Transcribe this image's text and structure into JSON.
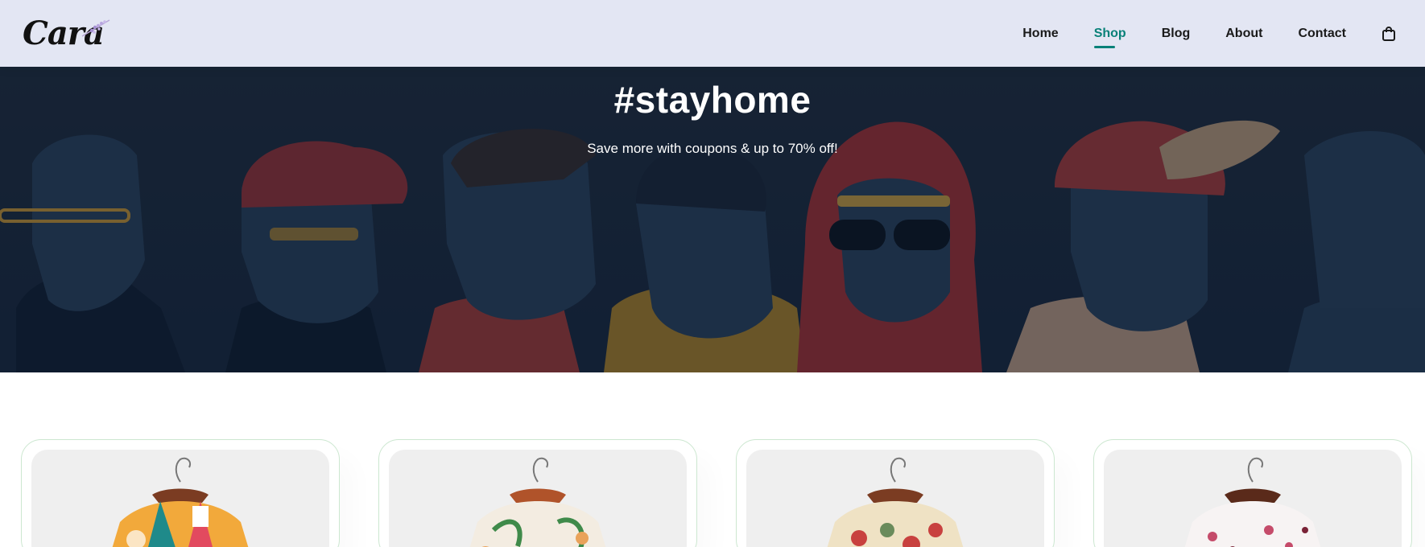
{
  "brand": {
    "name": "Cara",
    "accent": "#088178",
    "header_bg": "#e3e6f3"
  },
  "nav": {
    "items": [
      {
        "label": "Home",
        "active": false
      },
      {
        "label": "Shop",
        "active": true
      },
      {
        "label": "Blog",
        "active": false
      },
      {
        "label": "About",
        "active": false
      },
      {
        "label": "Contact",
        "active": false
      }
    ],
    "cart_icon": "shopping-bag-icon"
  },
  "hero": {
    "title": "#stayhome",
    "subtitle": "Save more with coupons & up to 70% off!"
  },
  "products": [
    {
      "image": "patchwork-floral-shirt",
      "colors": [
        "#f2a93b",
        "#1f8a8a",
        "#e24a5f",
        "#ffffff"
      ]
    },
    {
      "image": "leaf-print-shirt",
      "colors": [
        "#f3ece1",
        "#3f8a4a",
        "#e9a25a"
      ]
    },
    {
      "image": "dense-floral-shirt",
      "colors": [
        "#efe2c4",
        "#c8413f",
        "#6a8b5b"
      ]
    },
    {
      "image": "pink-blossom-shirt",
      "colors": [
        "#f7f3f3",
        "#c54b6a",
        "#7a2236"
      ]
    }
  ]
}
